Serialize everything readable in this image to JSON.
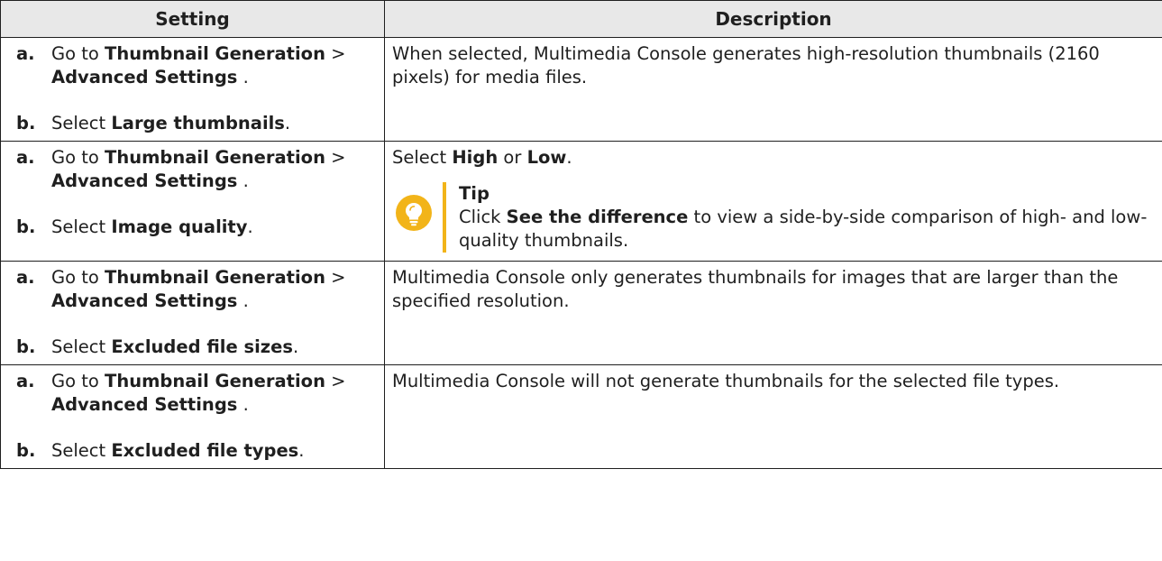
{
  "headers": {
    "setting": "Setting",
    "description": "Description"
  },
  "rows": [
    {
      "a_marker": "a.",
      "a_prefix": "Go to ",
      "a_bold1": "Thumbnail Generation",
      "a_sep": " > ",
      "a_bold2": "Advanced Settings",
      "a_suffix": " .",
      "b_marker": "b.",
      "b_prefix": "Select ",
      "b_bold": "Large thumbnails",
      "b_suffix": ".",
      "description": "When selected, Multimedia Console generates high-resolution thumbnails (2160 pixels) for media files."
    },
    {
      "a_marker": "a.",
      "a_prefix": "Go to ",
      "a_bold1": "Thumbnail Generation",
      "a_sep": " > ",
      "a_bold2": "Advanced Settings",
      "a_suffix": " .",
      "b_marker": "b.",
      "b_prefix": "Select ",
      "b_bold": "Image quality",
      "b_suffix": ".",
      "desc_prefix": "Select ",
      "desc_bold1": "High",
      "desc_mid": " or ",
      "desc_bold2": "Low",
      "desc_suffix": ".",
      "tip": {
        "icon": "lightbulb-icon",
        "title": "Tip",
        "prefix": "Click ",
        "bold": "See the difference",
        "suffix": " to view a side-by-side comparison of high- and low-quality thumbnails."
      }
    },
    {
      "a_marker": "a.",
      "a_prefix": "Go to ",
      "a_bold1": "Thumbnail Generation",
      "a_sep": " > ",
      "a_bold2": "Advanced Settings",
      "a_suffix": " .",
      "b_marker": "b.",
      "b_prefix": "Select ",
      "b_bold": "Excluded file sizes",
      "b_suffix": ".",
      "description": "Multimedia Console only generates thumbnails for images that are larger than the specified resolution."
    },
    {
      "a_marker": "a.",
      "a_prefix": "Go to ",
      "a_bold1": "Thumbnail Generation",
      "a_sep": " > ",
      "a_bold2": "Advanced Settings",
      "a_suffix": " .",
      "b_marker": "b.",
      "b_prefix": "Select ",
      "b_bold": "Excluded file types",
      "b_suffix": ".",
      "description": "Multimedia Console will not generate thumbnails for the selected file types."
    }
  ],
  "colors": {
    "header_bg": "#e8e8e8",
    "tip_accent": "#f2b419",
    "border": "#1f1f1f"
  }
}
